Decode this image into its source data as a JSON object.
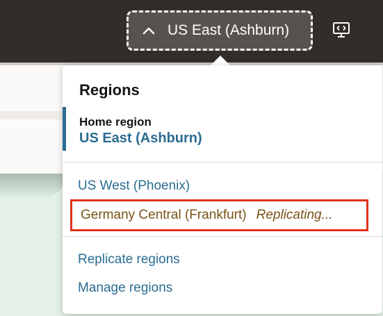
{
  "header": {
    "region_button_label": "US East (Ashburn)",
    "chevron_icon": "chevron-up-icon",
    "developer_tools_icon": "developer-tools-icon"
  },
  "regions_popup": {
    "title": "Regions",
    "home_region_label": "Home region",
    "home_region_value": "US East (Ashburn)",
    "regions": [
      {
        "name": "US West (Phoenix)",
        "status": ""
      },
      {
        "name": "Germany Central (Frankfurt)",
        "status": "Replicating..."
      }
    ],
    "actions": {
      "replicate": "Replicate regions",
      "manage": "Manage regions"
    }
  },
  "colors": {
    "header_bg": "#312d2a",
    "link": "#2a6c92",
    "highlight_border": "#e0321c",
    "replicating_text": "#7a5216"
  }
}
